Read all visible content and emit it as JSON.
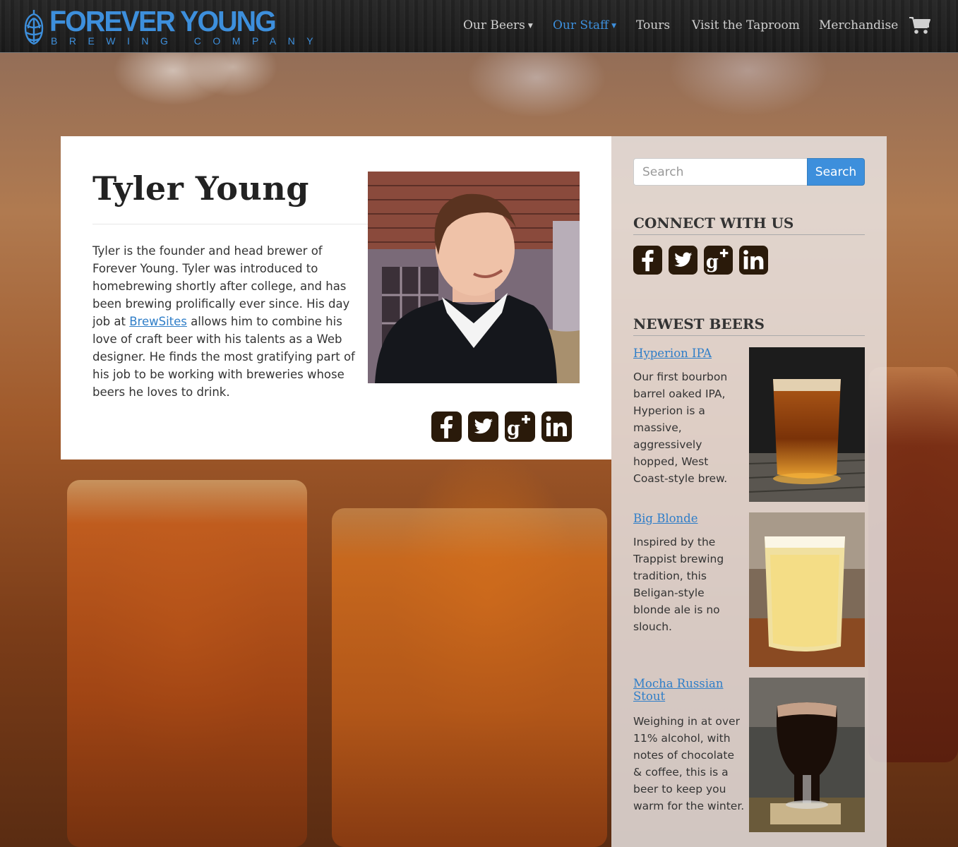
{
  "brand": {
    "name": "FOREVER YOUNG",
    "tagline": "BREWING COMPANY",
    "accent_color": "#3d8fdc"
  },
  "nav": {
    "items": [
      {
        "label": "Our Beers",
        "has_dropdown": true,
        "active": false
      },
      {
        "label": "Our Staff",
        "has_dropdown": true,
        "active": true
      },
      {
        "label": "Tours",
        "has_dropdown": false,
        "active": false
      },
      {
        "label": "Visit the Taproom",
        "has_dropdown": false,
        "active": false
      },
      {
        "label": "Merchandise",
        "has_dropdown": false,
        "active": false
      }
    ],
    "cart_icon": "shopping-cart-icon"
  },
  "profile": {
    "name": "Tyler Young",
    "bio_before_link": "Tyler is the founder and head brewer of Forever Young. Tyler was introduced to homebrewing shortly after college, and has been brewing prolifically ever since. His day job at ",
    "bio_link": "BrewSites",
    "bio_after_link": " allows him to combine his love of craft beer with his talents as a Web designer. He finds the most gratifying part of his job to be working with breweries whose beers he loves to drink.",
    "social": [
      "facebook-icon",
      "twitter-icon",
      "google-plus-icon",
      "linkedin-icon"
    ]
  },
  "sidebar": {
    "search": {
      "placeholder": "Search",
      "button_label": "Search"
    },
    "connect_heading": "CONNECT WITH US",
    "social": [
      "facebook-icon",
      "twitter-icon",
      "google-plus-icon",
      "linkedin-icon"
    ],
    "newest_heading": "NEWEST BEERS",
    "beers": [
      {
        "title": "Hyperion IPA",
        "description": "Our first bourbon barrel oaked IPA, Hyperion is a massive, aggressively hopped, West Coast-style brew."
      },
      {
        "title": "Big Blonde",
        "description": "Inspired by the Trappist brewing tradition, this Beligan-style blonde ale is no slouch."
      },
      {
        "title": "Mocha Russian Stout",
        "description": "Weighing in at over 11% alcohol, with notes of chocolate & coffee, this is a beer to keep you warm for the winter."
      }
    ]
  }
}
